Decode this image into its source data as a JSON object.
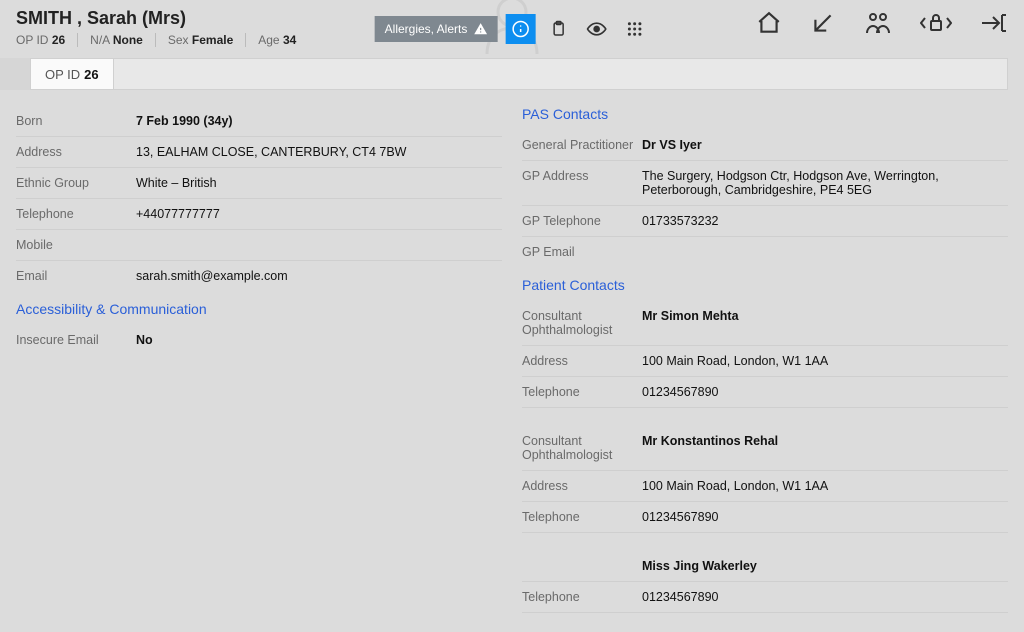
{
  "header": {
    "patient_name": "SMITH , Sarah (Mrs)",
    "op_id_label": "OP ID",
    "op_id_value": "26",
    "na_label": "N/A",
    "na_value": "None",
    "sex_label": "Sex",
    "sex_value": "Female",
    "age_label": "Age",
    "age_value": "34",
    "alerts_label": "Allergies, Alerts"
  },
  "tab": {
    "op_id_label": "OP ID",
    "op_id_value": "26"
  },
  "left": {
    "born_label": "Born",
    "born_value": "7 Feb 1990 (34y)",
    "address_label": "Address",
    "address_value": "13, EALHAM CLOSE, CANTERBURY, CT4 7BW",
    "ethnic_label": "Ethnic Group",
    "ethnic_value": "White – British",
    "tel_label": "Telephone",
    "tel_value": "+44077777777",
    "mobile_label": "Mobile",
    "mobile_value": "",
    "email_label": "Email",
    "email_value": "sarah.smith@example.com",
    "acc_title": "Accessibility & Communication",
    "insec_label": "Insecure Email",
    "insec_value": "No"
  },
  "right": {
    "pas_title": "PAS Contacts",
    "gp_label": "General Practitioner",
    "gp_value": "Dr VS Iyer",
    "gpaddr_label": "GP Address",
    "gpaddr_value": "The Surgery, Hodgson Ctr, Hodgson Ave, Werrington, Peterborough, Cambridgeshire, PE4 5EG",
    "gptel_label": "GP Telephone",
    "gptel_value": "01733573232",
    "gpemail_label": "GP Email",
    "gpemail_value": "",
    "patient_title": "Patient Contacts",
    "c1_role_label": "Consultant Ophthalmologist",
    "c1_name": "Mr Simon Mehta",
    "c1_addr_label": "Address",
    "c1_addr_value": "100 Main Road, London, W1 1AA",
    "c1_tel_label": "Telephone",
    "c1_tel_value": "01234567890",
    "c2_role_label": "Consultant Ophthalmologist",
    "c2_name": "Mr Konstantinos Rehal",
    "c2_addr_label": "Address",
    "c2_addr_value": "100 Main Road, London, W1 1AA",
    "c2_tel_label": "Telephone",
    "c2_tel_value": "01234567890",
    "c3_name": "Miss Jing Wakerley",
    "c3_tel_label": "Telephone",
    "c3_tel_value": "01234567890"
  }
}
